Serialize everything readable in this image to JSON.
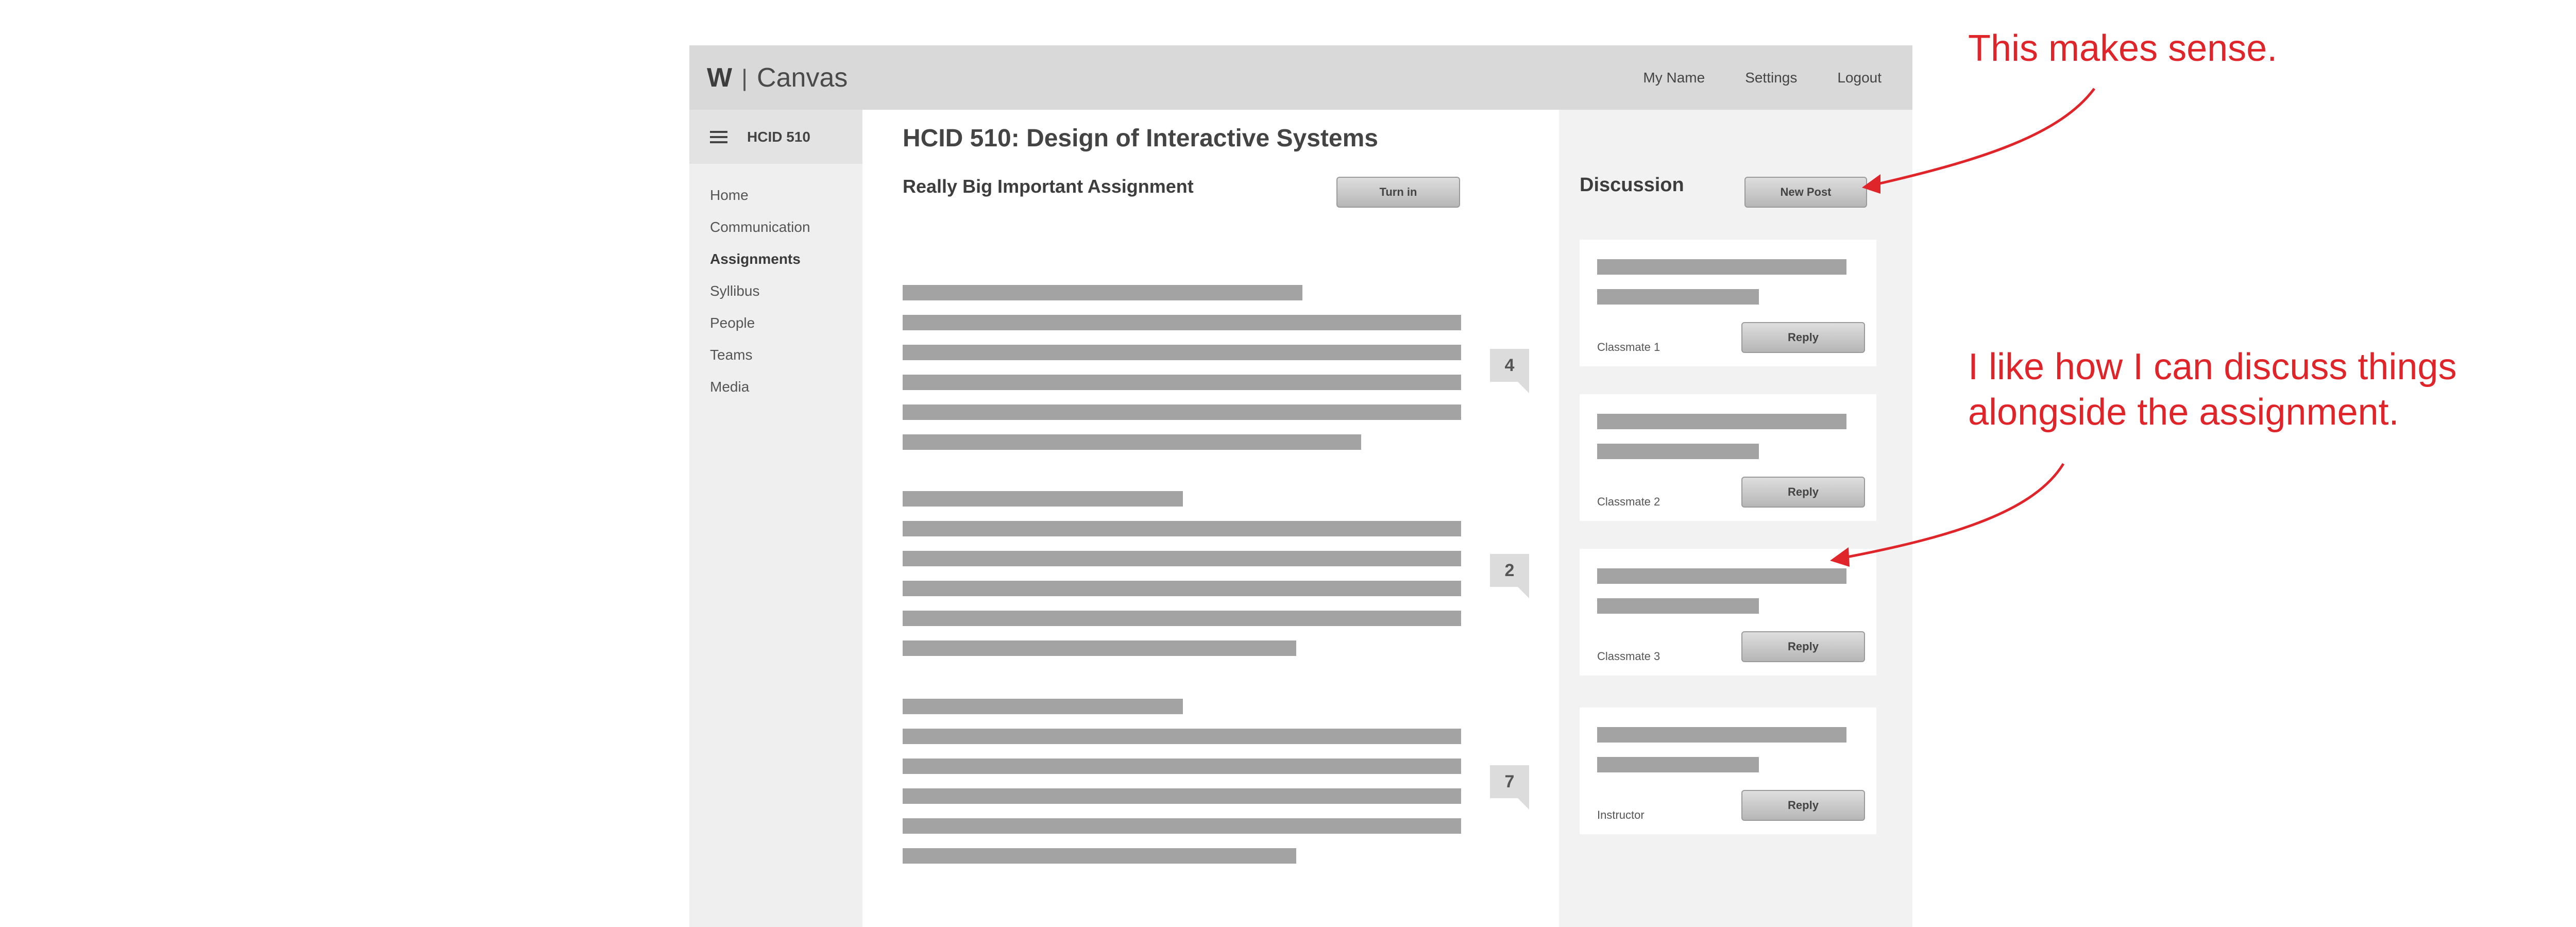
{
  "app": {
    "logo_w": "W",
    "logo_sep": "|",
    "logo_name": "Canvas",
    "nav": {
      "my_name": "My Name",
      "settings": "Settings",
      "logout": "Logout"
    }
  },
  "sidebar": {
    "course_code": "HCID 510",
    "items": [
      {
        "label": "Home",
        "active": false
      },
      {
        "label": "Communication",
        "active": false
      },
      {
        "label": "Assignments",
        "active": true
      },
      {
        "label": "Syllibus",
        "active": false
      },
      {
        "label": "People",
        "active": false
      },
      {
        "label": "Teams",
        "active": false
      },
      {
        "label": "Media",
        "active": false
      }
    ]
  },
  "main": {
    "page_title": "HCID 510: Design of Interactive Systems",
    "assignment_title": "Really Big Important Assignment",
    "turn_in_label": "Turn in",
    "paragraph_comment_counts": [
      "4",
      "2",
      "7"
    ]
  },
  "discussion": {
    "title": "Discussion",
    "new_post_label": "New Post",
    "reply_label": "Reply",
    "posts": [
      {
        "author": "Classmate 1"
      },
      {
        "author": "Classmate 2"
      },
      {
        "author": "Classmate 3"
      },
      {
        "author": "Instructor"
      }
    ]
  },
  "annotations": {
    "note_1": "This makes sense.",
    "note_2_line1": "I like how I can discuss things",
    "note_2_line2": "alongside the assignment."
  },
  "colors": {
    "annotation_red": "#e0252a",
    "topbar_gray": "#d9d9d9",
    "placeholder_bar_gray": "#a3a3a3"
  }
}
